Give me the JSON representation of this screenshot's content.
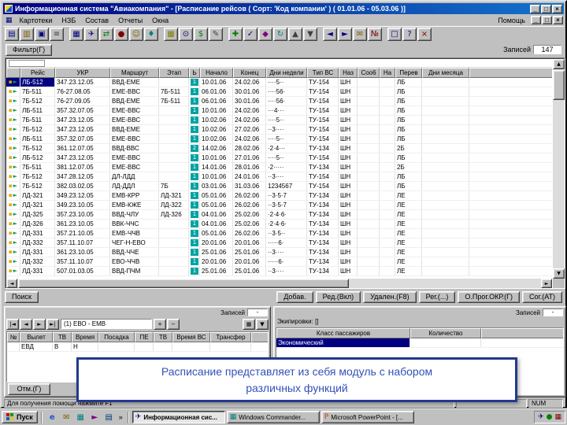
{
  "window": {
    "title": "Информационная система \"Авиакомпания\" - [Расписание рейсов ( Сорт: 'Код компании' ) ( 01.01.06 - 05.03.06 )]",
    "controls": {
      "minimize": "_",
      "maximize": "□",
      "close": "×"
    }
  },
  "menu": {
    "items": [
      {
        "id": "kartoteki",
        "label": "Картотеки"
      },
      {
        "id": "nzb",
        "label": "НЗБ"
      },
      {
        "id": "sostav",
        "label": "Состав"
      },
      {
        "id": "otchety",
        "label": "Отчеты"
      },
      {
        "id": "okna",
        "label": "Окна"
      }
    ],
    "help_label": "Помощь"
  },
  "toolbar": {
    "buttons": [
      {
        "id": "new",
        "glyph": "▤",
        "color": "#000080"
      },
      {
        "id": "open",
        "glyph": "▥",
        "color": "#806000"
      },
      {
        "id": "save",
        "glyph": "▣",
        "color": "#000080"
      },
      {
        "id": "print",
        "glyph": "≡",
        "color": "#404040"
      },
      {
        "id": "schedule",
        "glyph": "▦",
        "color": "#000080",
        "gap": true
      },
      {
        "id": "flights",
        "glyph": "✈",
        "color": "#000080"
      },
      {
        "id": "routes",
        "glyph": "⇄",
        "color": "#008000"
      },
      {
        "id": "airports",
        "glyph": "●",
        "color": "#800000"
      },
      {
        "id": "crews",
        "glyph": "☺",
        "color": "#806000"
      },
      {
        "id": "aircraft",
        "glyph": "♦",
        "color": "#008080"
      },
      {
        "id": "calendar",
        "glyph": "▦",
        "color": "#808000",
        "gap": true
      },
      {
        "id": "clock",
        "glyph": "⊙",
        "color": "#000080"
      },
      {
        "id": "tariffs",
        "glyph": "$",
        "color": "#008000"
      },
      {
        "id": "docs",
        "glyph": "✎",
        "color": "#404040"
      },
      {
        "id": "add-record",
        "glyph": "✚",
        "color": "#008000",
        "gap": true
      },
      {
        "id": "edit-record",
        "glyph": "✓",
        "color": "#000080"
      },
      {
        "id": "find",
        "glyph": "◆",
        "color": "#800080"
      },
      {
        "id": "refresh",
        "glyph": "↻",
        "color": "#008080"
      },
      {
        "id": "sort-asc",
        "glyph": "▲",
        "color": "#404040"
      },
      {
        "id": "sort-desc",
        "glyph": "▼",
        "color": "#404040"
      },
      {
        "id": "prev",
        "glyph": "◄",
        "color": "#000080",
        "gap": true
      },
      {
        "id": "next",
        "glyph": "►",
        "color": "#000080"
      },
      {
        "id": "mail",
        "glyph": "✉",
        "color": "#806000"
      },
      {
        "id": "report",
        "glyph": "№",
        "color": "#800000"
      },
      {
        "id": "window",
        "glyph": "□",
        "color": "#000080",
        "gap": true
      },
      {
        "id": "help",
        "glyph": "?",
        "color": "#000080"
      },
      {
        "id": "exit",
        "glyph": "×",
        "color": "#800000"
      }
    ]
  },
  "filter": {
    "button_label": "Фильтр(Г)",
    "records_label": "Записей",
    "records_value": "147"
  },
  "schedule_table": {
    "columns": [
      "",
      "Рейс",
      "УКР",
      "Маршрут",
      "Этап",
      "Ь",
      "Начало",
      "Конец",
      "Дни недели",
      "Тип ВС",
      "Наз",
      "Соо6",
      "На",
      "Перев",
      "Дни месяца"
    ],
    "selected_row": 0,
    "rows": [
      [
        "ЛБ-512",
        "347.23.12.05",
        "ВВД-ЕМЕ",
        "",
        "1",
        "10.01.06",
        "24.02.06",
        "····5··",
        "ТУ-154",
        "ШН",
        "",
        "",
        "ЛБ",
        ""
      ],
      [
        "7Б-511",
        "76-27.08.05",
        "ЕМЕ-ВВС",
        "7Б-511",
        "1",
        "06.01.06",
        "30.01.06",
        "····56·",
        "ТУ-154",
        "ШН",
        "",
        "",
        "ЛБ",
        ""
      ],
      [
        "7Б-512",
        "76-27.09.05",
        "ВВД-ЕМЕ",
        "7Б-511",
        "1",
        "06.01.06",
        "30.01.06",
        "····56·",
        "ТУ-154",
        "ШН",
        "",
        "",
        "ЛБ",
        ""
      ],
      [
        "ЛБ-511",
        "357.32.07.05",
        "ЕМЕ-ВВС",
        "",
        "1",
        "10.01.06",
        "24.02.06",
        "···4···",
        "ТУ-154",
        "ШН",
        "",
        "",
        "ЛБ",
        ""
      ],
      [
        "7Б-511",
        "347.23.12.05",
        "ЕМЕ-ВВС",
        "",
        "1",
        "10.02.06",
        "24.02.06",
        "····5··",
        "ТУ-154",
        "ШН",
        "",
        "",
        "ЛБ",
        ""
      ],
      [
        "7Б-512",
        "347.23.12.05",
        "ВВД-ЕМЕ",
        "",
        "1",
        "10.02.06",
        "27.02.06",
        "··3····",
        "ТУ-154",
        "ШН",
        "",
        "",
        "ЛБ",
        ""
      ],
      [
        "ЛБ-511",
        "357.32.07.05",
        "ЕМЕ-ВВС",
        "",
        "1",
        "10.02.06",
        "24.02.06",
        "····5··",
        "ТУ-154",
        "ШН",
        "",
        "",
        "ЛБ",
        ""
      ],
      [
        "7Б-512",
        "361.12.07.05",
        "ВВД-ВВС",
        "",
        "2",
        "14.02.06",
        "28.02.06",
        "·2·4···",
        "ТУ-134",
        "ШН",
        "",
        "",
        "2Б",
        ""
      ],
      [
        "ЛБ-512",
        "347.23.12.05",
        "ЕМЕ-ВВС",
        "",
        "1",
        "10.01.06",
        "27.01.06",
        "····5··",
        "ТУ-154",
        "ШН",
        "",
        "",
        "ЛБ",
        ""
      ],
      [
        "7Б-511",
        "381.12.07.05",
        "ЕМЕ-ВВС",
        "",
        "1",
        "14.01.06",
        "28.01.06",
        "·2·····",
        "ТУ-134",
        "ШН",
        "",
        "",
        "2Б",
        ""
      ],
      [
        "7Б-512",
        "347.28.12.05",
        "ДЛ-ЛДД",
        "",
        "1",
        "10.01.06",
        "24.01.06",
        "··3····",
        "ТУ-154",
        "ШН",
        "",
        "",
        "ЛБ",
        ""
      ],
      [
        "7Б-512",
        "382.03.02.05",
        "ЛД-ДДЛ",
        "7Б",
        "1",
        "03.01.06",
        "31.03.06",
        "1234567",
        "ТУ-154",
        "ШН",
        "",
        "",
        "ЛБ",
        ""
      ],
      [
        "ЛД-321",
        "349.23.12.05",
        "ЕМВ-КРР",
        "ЛД-321",
        "1",
        "05.01.06",
        "26.02.06",
        "··3·5·7",
        "ТУ-134",
        "ШН",
        "",
        "",
        "ЛЕ",
        ""
      ],
      [
        "ЛД-321",
        "349.23.10.05",
        "ЕМВ-КЖЕ",
        "ЛД-322",
        "1",
        "05.01.06",
        "26.02.06",
        "··3·5·7",
        "ТУ-134",
        "ШН",
        "",
        "",
        "ЛЕ",
        ""
      ],
      [
        "ЛД-325",
        "357.23.10.05",
        "ВВД-ЧЛУ",
        "ЛД-326",
        "1",
        "04.01.06",
        "25.02.06",
        "·2·4·6·",
        "ТУ-134",
        "ШН",
        "",
        "",
        "ЛЕ",
        ""
      ],
      [
        "ЛД-326",
        "361.23.10.05",
        "ВВК-ЧЧС",
        "",
        "1",
        "04.01.06",
        "25.02.06",
        "·2·4·6·",
        "ТУ-134",
        "ШН",
        "",
        "",
        "ЛЕ",
        ""
      ],
      [
        "ЛД-331",
        "357.21.10.05",
        "ЕМВ-ЧЧВ",
        "",
        "1",
        "05.01.06",
        "26.02.06",
        "··3·5··",
        "ТУ-134",
        "ШН",
        "",
        "",
        "ЛЕ",
        ""
      ],
      [
        "ЛД-332",
        "357.11.10.07",
        "ЧЕГ-Н-ЕВО",
        "",
        "1",
        "20.01.06",
        "20.01.06",
        "·····6·",
        "ТУ-134",
        "ШН",
        "",
        "",
        "ЛЕ",
        ""
      ],
      [
        "ЛД-331",
        "361.23.10.05",
        "ВВД-ЧЧЕ",
        "",
        "1",
        "25.01.06",
        "25.01.06",
        "··3····",
        "ТУ-134",
        "ШН",
        "",
        "",
        "ЛЕ",
        ""
      ],
      [
        "ЛД-332",
        "357.11.10.07",
        "ЕВО-ЧЧВ",
        "",
        "1",
        "20.01.06",
        "20.01.06",
        "·····6·",
        "ТУ-134",
        "ШН",
        "",
        "",
        "ЛЕ",
        ""
      ],
      [
        "ЛД-331",
        "507.01.03.05",
        "ВВД-ПЧМ",
        "",
        "1",
        "25.01.06",
        "25.01.06",
        "··3····",
        "ТУ-134",
        "ШН",
        "",
        "",
        "ЛЕ",
        ""
      ]
    ]
  },
  "actions": [
    {
      "id": "search",
      "label": "Поиск"
    },
    {
      "id": "add",
      "label": "Добав."
    },
    {
      "id": "edit",
      "label": "Ред.(Вкл)"
    },
    {
      "id": "delete",
      "label": "Удален.(F8)"
    },
    {
      "id": "reg",
      "label": "Рег.(...)"
    },
    {
      "id": "prog",
      "label": "О.Прог.ОКР.(Г)"
    },
    {
      "id": "sog",
      "label": "Сог.(АТ)"
    }
  ],
  "legs_panel": {
    "records_label": "Записей",
    "records_value": "-",
    "title": "(1) ЕВО - ЕМВ",
    "nav_left": [
      {
        "id": "first-record-button",
        "glyph": "|◄"
      },
      {
        "id": "prev-record-button",
        "glyph": "◄"
      },
      {
        "id": "next-record-button",
        "glyph": "►"
      },
      {
        "id": "last-record-button",
        "glyph": "►|"
      }
    ],
    "nav_right": [
      {
        "id": "add-leg-button",
        "glyph": "+"
      },
      {
        "id": "delete-leg-button",
        "glyph": "−"
      }
    ],
    "tools": [
      {
        "id": "legs-grid-button",
        "glyph": "▦"
      },
      {
        "id": "legs-menu-button",
        "glyph": "▼"
      }
    ],
    "columns": [
      "№",
      "Вылет",
      "ТВ",
      "Время",
      "Посадка",
      "ПЕ",
      "ТВ",
      "Время ВС",
      "Трансфер"
    ],
    "rows": [
      [
        "",
        "ЕВД",
        "В",
        "Н",
        "",
        "",
        "",
        "",
        ""
      ]
    ],
    "cancel_label": "Отм.(Г)"
  },
  "equip_panel": {
    "records_label": "Записей",
    "records_value": "-",
    "title": "Экипировки: []",
    "columns": [
      "Класс пассажиров",
      "Количество"
    ],
    "selected_row": 0,
    "rows": [
      [
        "Экономический",
        ""
      ]
    ]
  },
  "overlay": {
    "line1": "Расписание представляет из себя модуль с набором",
    "line2": "различных функций"
  },
  "statusbar": {
    "help_text": "Для получения помощи нажмите F1",
    "num_indicator": "NUM"
  },
  "taskbar": {
    "start_label": "Пуск",
    "quick_launch": [
      {
        "id": "ie",
        "glyph": "e",
        "color": "#1660c8"
      },
      {
        "id": "outlook",
        "glyph": "✉",
        "color": "#806000"
      },
      {
        "id": "show-desktop",
        "glyph": "▦",
        "color": "#008080"
      },
      {
        "id": "media-player",
        "glyph": "►",
        "color": "#800080"
      },
      {
        "id": "explorer",
        "glyph": "▤",
        "color": "#004080"
      }
    ],
    "overflow_glyph": "»",
    "tasks": [
      {
        "id": "infosystem",
        "icon_glyph": "✈",
        "icon_color": "#000080",
        "label": "Информационная сис...",
        "active": true
      },
      {
        "id": "commander",
        "icon_glyph": "▦",
        "icon_color": "#008080",
        "label": "Windows Commander...",
        "active": false
      },
      {
        "id": "powerpoint",
        "icon_glyph": "P",
        "icon_color": "#c84000",
        "label": "Microsoft PowerPoint - [...",
        "active": false
      }
    ],
    "tray_icons": [
      {
        "id": "scheduler-tray-icon",
        "glyph": "✈",
        "color": "#000080"
      },
      {
        "id": "antivirus-tray-icon",
        "glyph": "●",
        "color": "#008000"
      },
      {
        "id": "network-tray-icon",
        "glyph": "▦",
        "color": "#800000"
      }
    ]
  }
}
